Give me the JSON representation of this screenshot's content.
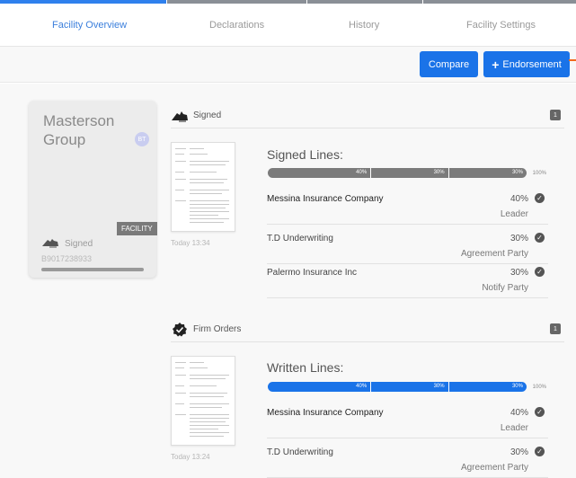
{
  "tabs": [
    {
      "label": "Facility Overview",
      "active": true
    },
    {
      "label": "Declarations",
      "active": false
    },
    {
      "label": "History",
      "active": false
    },
    {
      "label": "Facility Settings",
      "active": false
    }
  ],
  "toolbar": {
    "compare_label": "Compare",
    "endorsement_label": "Endorsement",
    "plus": "+"
  },
  "facility": {
    "name": "Masterson Group",
    "badge": "BT",
    "tag": "FACILITY",
    "status": "Signed",
    "ref": "B9017238933",
    "icon": "signing-hand-icon"
  },
  "signed_section": {
    "title": "Signed",
    "count": "1",
    "icon": "signing-hand-icon",
    "doc_time": "Today 13:34",
    "lines_title": "Signed Lines:",
    "bar_color": "#7b7b7b",
    "segments": [
      {
        "label": "40%",
        "value": 40
      },
      {
        "label": "30%",
        "value": 30
      },
      {
        "label": "30%",
        "value": 30
      }
    ],
    "total": "100%",
    "rows": [
      {
        "company": "Messina Insurance Company",
        "share": "40%",
        "role": "Leader",
        "bold": true
      },
      {
        "company": "T.D Underwriting",
        "share": "30%",
        "role": "Agreement Party",
        "bold": false
      },
      {
        "company": "Palermo Insurance Inc",
        "share": "30%",
        "role": "Notify Party",
        "bold": false
      }
    ]
  },
  "firm_section": {
    "title": "Firm Orders",
    "count": "1",
    "icon": "verified-badge-icon",
    "doc_time": "Today 13:24",
    "lines_title": "Written Lines:",
    "bar_color": "#1a73e8",
    "segments": [
      {
        "label": "40%",
        "value": 40
      },
      {
        "label": "30%",
        "value": 30
      },
      {
        "label": "30%",
        "value": 30
      }
    ],
    "total": "100%",
    "rows": [
      {
        "company": "Messina Insurance Company",
        "share": "40%",
        "role": "Leader",
        "bold": true
      },
      {
        "company": "T.D Underwriting",
        "share": "30%",
        "role": "Agreement Party",
        "bold": false
      }
    ]
  },
  "colors": {
    "accent": "#1a73e8",
    "active_tab": "#3b7fdc",
    "orange": "#f26b1d"
  }
}
